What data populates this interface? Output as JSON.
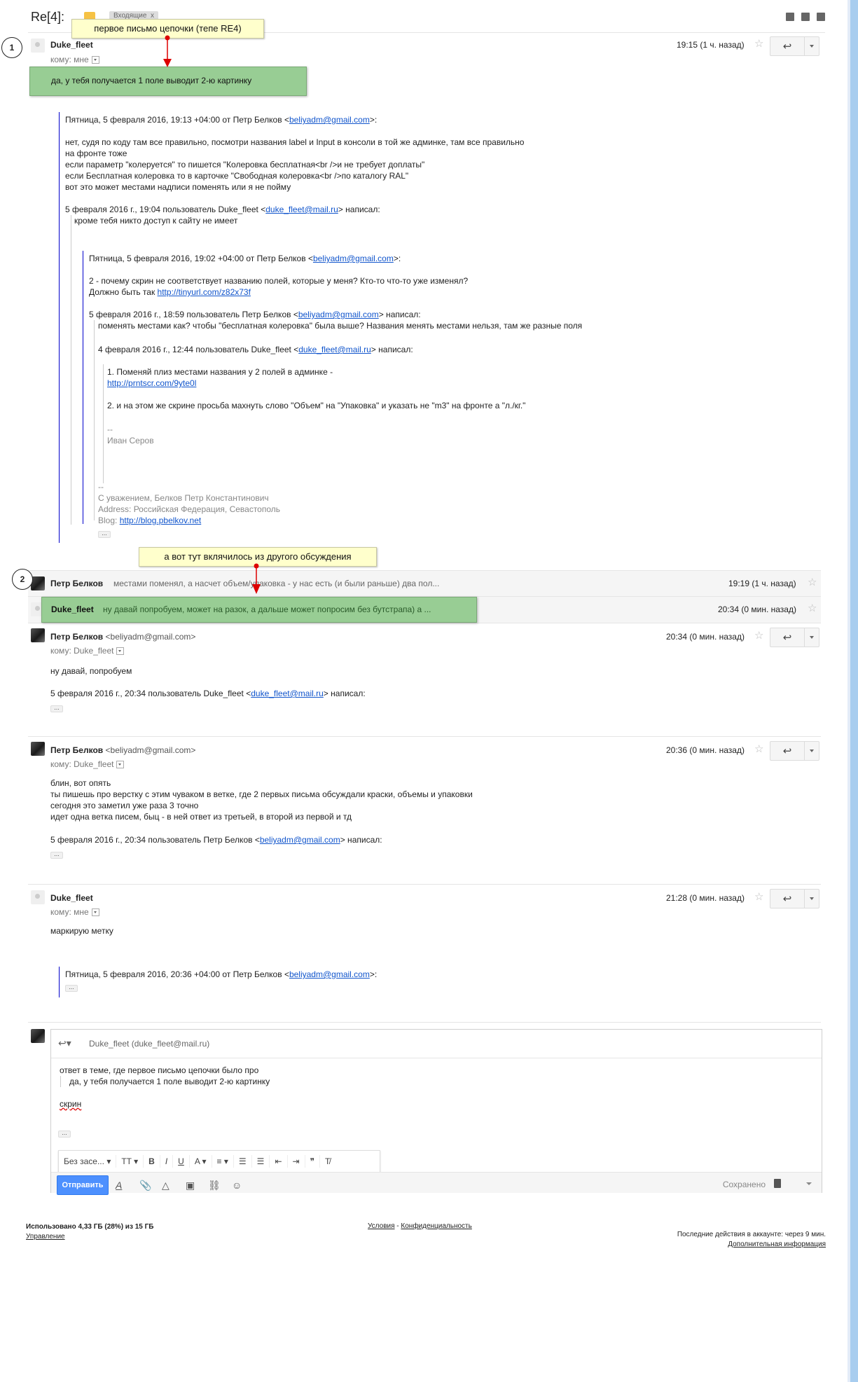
{
  "thread": {
    "subject": "Re[4]:",
    "label": "Входящие",
    "label_close": "x"
  },
  "annotations": {
    "note1": "первое письмо цепочки (тепе RE4)",
    "green1": "да, у тебя получается 1 поле выводит 2-ю картинку",
    "num1": "1",
    "note2": "а вот тут вклячилось из другого обсуждения",
    "num2": "2"
  },
  "msg1": {
    "sender": "Duke_fleet",
    "to": "кому: мне",
    "time": "19:15 (1 ч. назад)",
    "quote_header": "Пятница, 5 февраля 2016, 19:13 +04:00 от Петр Белков <",
    "quote_header_email": "beliyadm@gmail.com",
    "quote_header_end": ">:",
    "lines": [
      "нет, судя по коду там все правильно, посмотри названия label и Input в консоли в той же админке, там все правильно",
      "на фронте тоже",
      "если параметр \"колеруется\" то пишется \"Колеровка бесплатная<br />и не требует доплаты\"",
      "если Бесплатная колеровка то в карточке \"Свободная колеровка<br />по каталогу RAL\"",
      "вот это может местами надписи поменять или я не пойму"
    ],
    "q2_header": "5 февраля 2016 г., 19:04 пользователь Duke_fleet <",
    "q2_email": "duke_fleet@mail.ru",
    "q2_header_end": "> написал:",
    "q2_line": "кроме тебя никто доступ к сайту не имеет",
    "q3_header": "Пятница, 5 февраля 2016, 19:02 +04:00 от Петр Белков <",
    "q3_email": "beliyadm@gmail.com",
    "q3_header_end": ">:",
    "q3_line1": "2 - почему скрин не соответствует названию полей, которые у меня? Кто-то что-то уже изменял?",
    "q3_line2": "Должно быть так ",
    "q3_link": "http://tinyurl.com/z82x73f",
    "q4_header": "5 февраля 2016 г., 18:59 пользователь Петр Белков <",
    "q4_email": "beliyadm@gmail.com",
    "q4_header_end": "> написал:",
    "q4_line": "поменять местами как? чтобы \"бесплатная колеровка\" была выше? Названия менять местами нельзя, там же разные поля",
    "q5_header": "4 февраля 2016 г., 12:44 пользователь Duke_fleet <",
    "q5_email": "duke_fleet@mail.ru",
    "q5_header_end": "> написал:",
    "q5_line1": "1. Поменяй плиз местами названия у 2 полей в админке -",
    "q5_link": "http://prntscr.com/9yte0l",
    "q5_line2": "2. и на этом же скрине просьба махнуть слово \"Объем\" на \"Упаковка\" и указать не \"m3\" на фронте а \"л./кг.\"",
    "sig1_dash": "--",
    "sig1_name": "Иван Серов",
    "sig2_dash": "--",
    "sig2_line1": "С уважением, Белков Петр Константинович",
    "sig2_line2": "Address: Российская Федерация, Севастополь",
    "sig2_blog": "Blog: ",
    "sig2_link": "http://blog.pbelkov.net",
    "dots": "..."
  },
  "collapsed1": {
    "sender": "Петр Белков",
    "snippet": "местами поменял, а насчет объем/упаковка - у нас есть (и были раньше) два пол...",
    "time": "19:19 (1 ч. назад)"
  },
  "collapsed2": {
    "sender": "Duke_fleet",
    "snippet": "ну давай попробуем, может на разок, а дальше может попросим без бутстрапа) а ...",
    "time": "20:34 (0 мин. назад)"
  },
  "msg2": {
    "sender": "Петр Белков",
    "email": "<beliyadm@gmail.com>",
    "to": "кому: Duke_fleet",
    "time": "20:34 (0 мин. назад)",
    "body": "ну давай, попробуем",
    "quote_header": "5 февраля 2016 г., 20:34 пользователь Duke_fleet <",
    "quote_email": "duke_fleet@mail.ru",
    "quote_end": "> написал:",
    "dots": "..."
  },
  "msg3": {
    "sender": "Петр Белков",
    "email": "<beliyadm@gmail.com>",
    "to": "кому: Duke_fleet",
    "time": "20:36 (0 мин. назад)",
    "lines": [
      "блин, вот опять",
      "ты пишешь про верстку с этим чуваком в ветке, где 2 первых письма обсуждали краски, объемы и упаковки",
      "сегодня это заметил уже раза 3 точно",
      "идет одна ветка писем, быц - в ней ответ из третьей, в второй из первой и тд"
    ],
    "quote_header": "5 февраля 2016 г., 20:34 пользователь Петр Белков <",
    "quote_email": "beliyadm@gmail.com",
    "quote_end": "> написал:",
    "dots": "..."
  },
  "msg4": {
    "sender": "Duke_fleet",
    "to": "кому: мне",
    "time": "21:28 (0 мин. назад)",
    "body": "маркирую метку",
    "quote_header": "Пятница, 5 февраля 2016, 20:36 +04:00 от Петр Белков <",
    "quote_email": "beliyadm@gmail.com",
    "quote_end": ">:",
    "dots": "..."
  },
  "compose": {
    "to": "Duke_fleet (duke_fleet@mail.ru)",
    "line1": "ответ в теме, где первое письмо цепочки было про",
    "line2": "да, у тебя получается 1 поле выводит 2-ю картинку",
    "line3": "скрин",
    "dots": "...",
    "font_select": "Без засе...",
    "send": "Отправить",
    "saved": "Сохранено"
  },
  "footer": {
    "storage": "Использовано 4,33 ГБ (28%) из 15 ГБ",
    "manage": "Управление",
    "terms": "Условия",
    "sep": " - ",
    "privacy": "Конфиденциальность",
    "activity": "Последние действия в аккаунте: через 9 мин.",
    "details": "Дополнительная информация"
  }
}
